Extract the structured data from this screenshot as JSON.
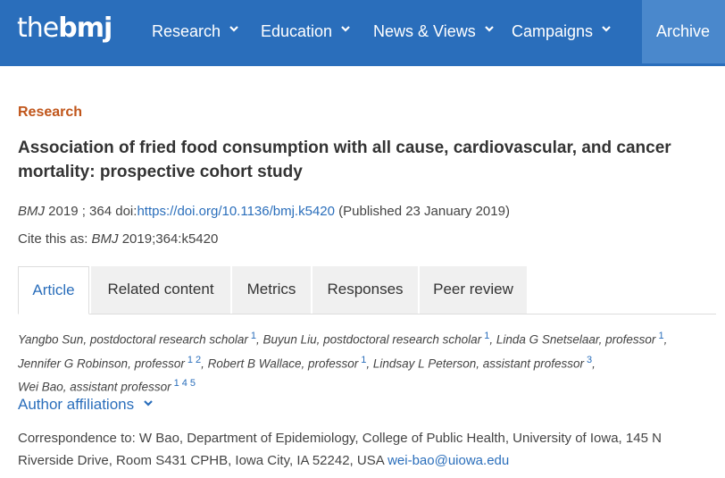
{
  "nav": {
    "logo_thin": "the",
    "logo_bold": "bmj",
    "items": [
      "Research",
      "Education",
      "News & Views",
      "Campaigns"
    ],
    "archive": "Archive"
  },
  "article": {
    "section": "Research",
    "title": "Association of fried food consumption with all cause, cardiovascular, and cancer mortality: prospective cohort study",
    "citation": {
      "journal": "BMJ",
      "year_volume": "2019 ; 364",
      "doi_label": "doi:",
      "doi_link": "https://doi.org/10.1136/bmj.k5420",
      "published": "(Published 23 January 2019)"
    },
    "cite_this": {
      "label": "Cite this as:",
      "journal": "BMJ",
      "ref": "2019;364:k5420"
    }
  },
  "tabs": [
    "Article",
    "Related content",
    "Metrics",
    "Responses",
    "Peer review"
  ],
  "authors": [
    {
      "name": "Yangbo Sun, postdoctoral research scholar",
      "sup": "1"
    },
    {
      "name": "Buyun Liu, postdoctoral research scholar",
      "sup": "1"
    },
    {
      "name": "Linda G Snetselaar, professor",
      "sup": "1"
    },
    {
      "name": "Jennifer G Robinson, professor",
      "sup": "1 2"
    },
    {
      "name": "Robert B Wallace, professor",
      "sup": "1"
    },
    {
      "name": "Lindsay L Peterson, assistant professor",
      "sup": "3"
    },
    {
      "name": "Wei Bao, assistant professor",
      "sup": "1 4 5"
    }
  ],
  "affiliations_label": "Author affiliations",
  "correspondence": {
    "text": "Correspondence to: W Bao, Department of Epidemiology, College of Public Health, University of Iowa, 145 N Riverside Drive, Room S431 CPHB, Iowa City, IA 52242, USA",
    "email": "wei-bao@uiowa.edu"
  },
  "colors": {
    "nav_bg": "#2a6ebb",
    "archive_bg": "#4a88cc",
    "section_label": "#c0551a",
    "link": "#2a6ebb"
  }
}
